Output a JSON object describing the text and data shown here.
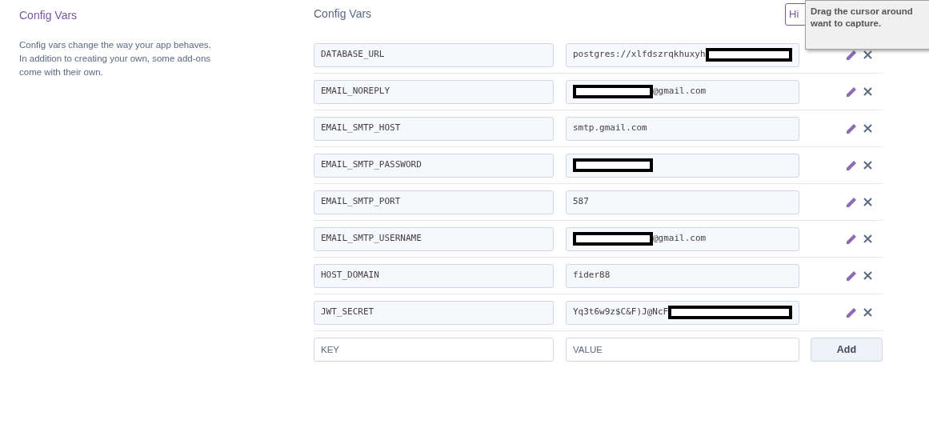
{
  "sidebar": {
    "title": "Config Vars",
    "description": "Config vars change the way your app behaves. In addition to creating your own, some add-ons come with their own."
  },
  "panel": {
    "title": "Config Vars",
    "hide_button": "Hi"
  },
  "vars": [
    {
      "key": "DATABASE_URL",
      "value": [
        {
          "kind": "text",
          "text": "postgres://xlfdszrqkhuxyh"
        },
        {
          "kind": "redacted"
        }
      ]
    },
    {
      "key": "EMAIL_NOREPLY",
      "value": [
        {
          "kind": "redacted"
        },
        {
          "kind": "text",
          "text": "@gmail.com"
        }
      ]
    },
    {
      "key": "EMAIL_SMTP_HOST",
      "value": [
        {
          "kind": "text",
          "text": "smtp.gmail.com"
        }
      ]
    },
    {
      "key": "EMAIL_SMTP_PASSWORD",
      "value": [
        {
          "kind": "redacted"
        }
      ]
    },
    {
      "key": "EMAIL_SMTP_PORT",
      "value": [
        {
          "kind": "text",
          "text": "587"
        }
      ]
    },
    {
      "key": "EMAIL_SMTP_USERNAME",
      "value": [
        {
          "kind": "redacted"
        },
        {
          "kind": "text",
          "text": "@gmail.com"
        }
      ]
    },
    {
      "key": "HOST_DOMAIN",
      "value": [
        {
          "kind": "text",
          "text": "fider88"
        }
      ]
    },
    {
      "key": "JWT_SECRET",
      "value": [
        {
          "kind": "text",
          "text": "Yq3t6w9z$C&F)J@NcF"
        },
        {
          "kind": "redacted"
        }
      ]
    }
  ],
  "new_var": {
    "key_placeholder": "KEY",
    "value_placeholder": "VALUE",
    "add_button": "Add"
  },
  "tooltip": {
    "lines": [
      "Drag the cursor around",
      "want to capture."
    ]
  }
}
